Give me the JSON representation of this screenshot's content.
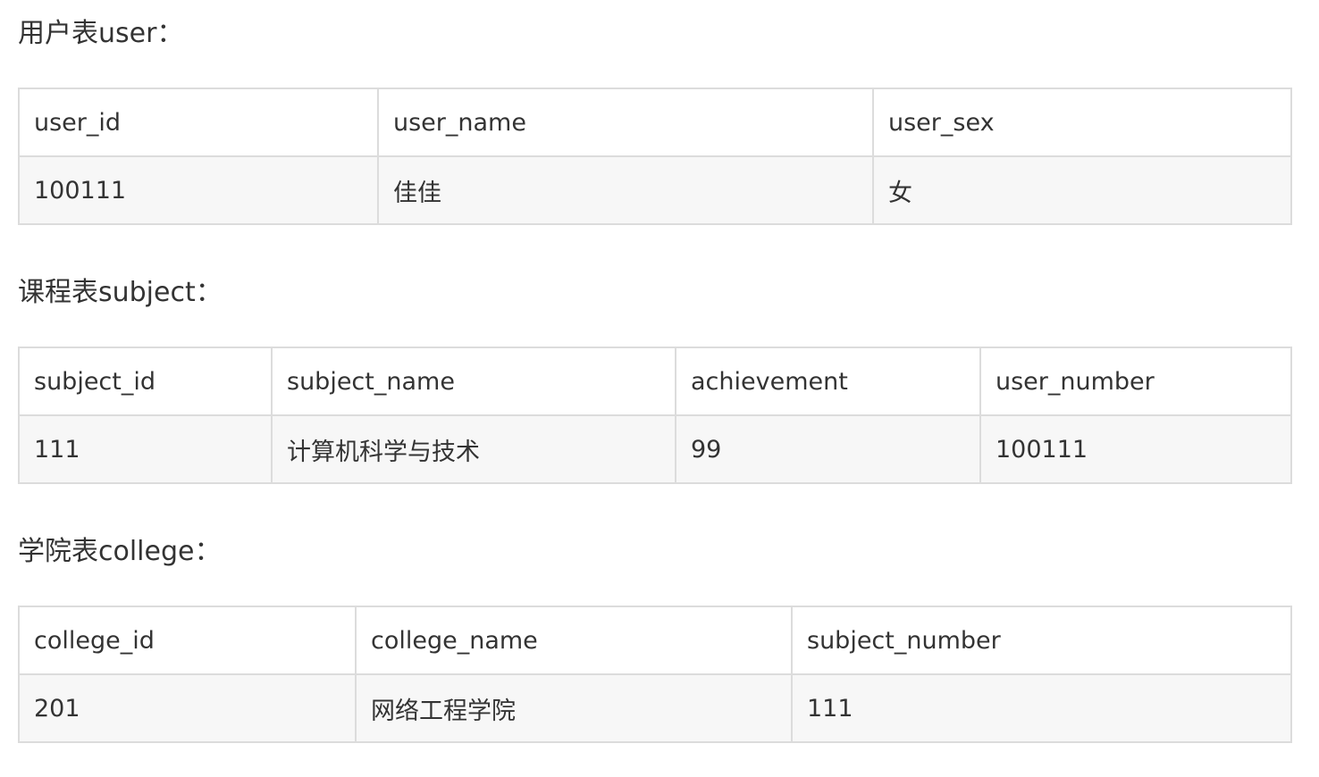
{
  "sections": [
    {
      "title": "用户表user：",
      "headers": [
        "user_id",
        "user_name",
        "user_sex"
      ],
      "rows": [
        [
          "100111",
          "佳佳",
          "女"
        ]
      ]
    },
    {
      "title": "课程表subject：",
      "headers": [
        "subject_id",
        "subject_name",
        "achievement",
        "user_number"
      ],
      "rows": [
        [
          "111",
          "计算机科学与技术",
          "99",
          "100111"
        ]
      ]
    },
    {
      "title": "学院表college：",
      "headers": [
        "college_id",
        "college_name",
        "subject_number"
      ],
      "rows": [
        [
          "201",
          "网络工程学院",
          "111"
        ]
      ]
    }
  ]
}
